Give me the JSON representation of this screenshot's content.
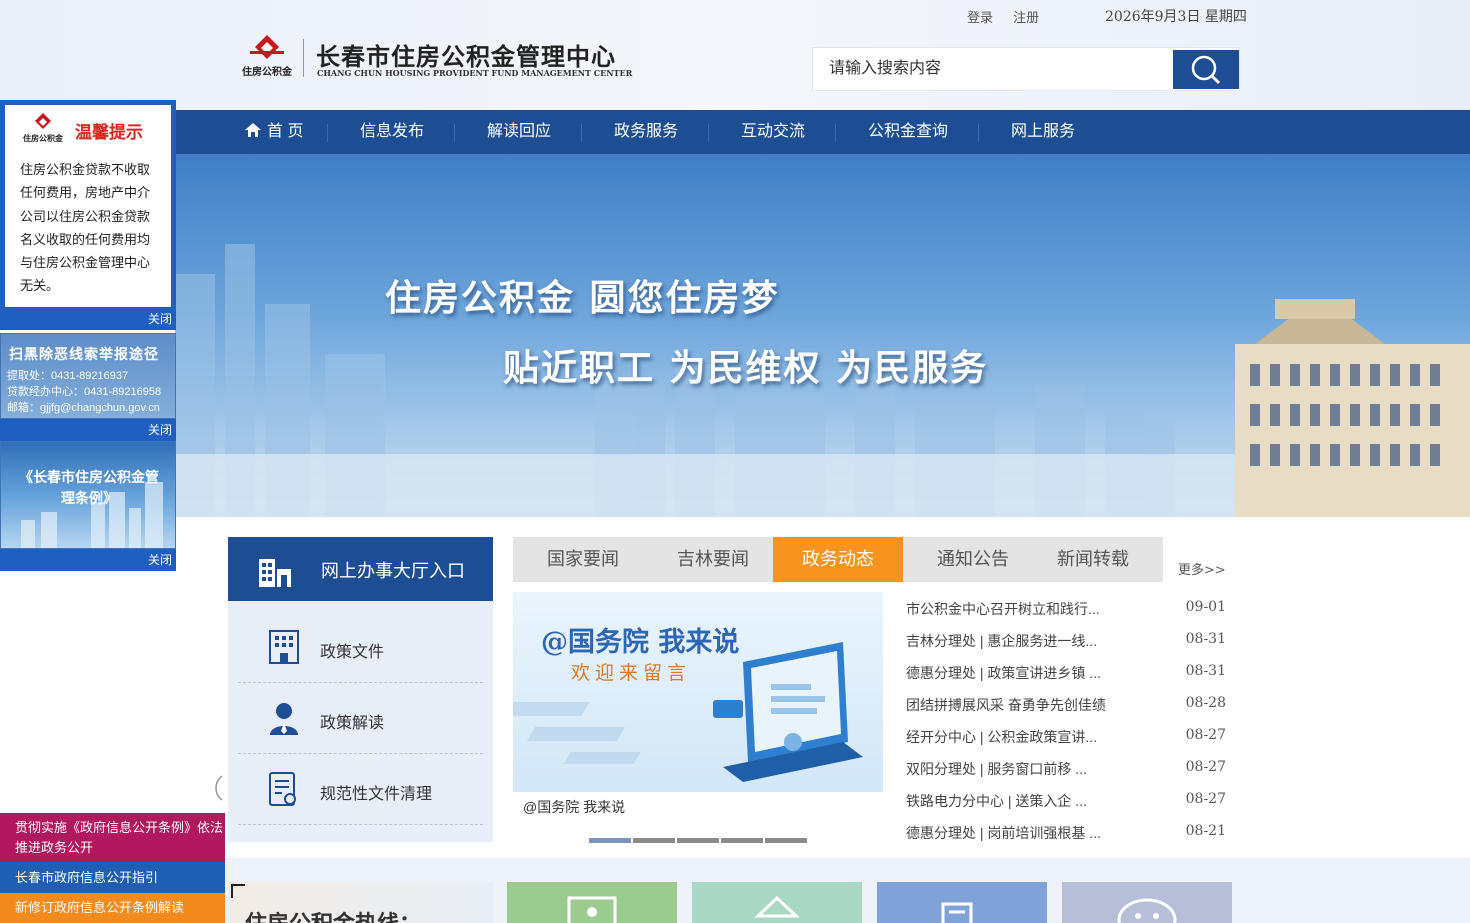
{
  "header": {
    "login": "登录",
    "register": "注册",
    "date": "2026年9月3日 星期四",
    "logo_cn": "长春市住房公积金管理中心",
    "logo_en": "CHANG CHUN HOUSING PROVIDENT FUND MANAGEMENT CENTER",
    "logo_mark_text": "住房公积金",
    "search_placeholder": "请输入搜索内容"
  },
  "nav": [
    "首 页",
    "信息发布",
    "解读回应",
    "政务服务",
    "互动交流",
    "公积金查询",
    "网上服务"
  ],
  "banner": {
    "slogan1": "住房公积金  圆您住房梦",
    "slogan2": "贴近职工  为民维权  为民服务"
  },
  "floats": {
    "tip_title": "温馨提示",
    "tip_body": "住房公积金贷款不收取任何费用，房地产中介公司以住房公积金贷款名义收取的任何费用均与住房公积金管理中心无关。",
    "close": "关闭",
    "report_title": "扫黑除恶线索举报途径",
    "report_lines": [
      "提取处：0431-89216937",
      "贷款经办中心：0431-89216958",
      "邮箱：gjjfg@changchun.gov.cn"
    ],
    "regs_title": "《长春市住房公积金管理条例》"
  },
  "bottom_left": [
    "贯彻实施《政府信息公开条例》依法推进政务公开",
    "长春市政府信息公开指引",
    "新修订政府信息公开条例解读"
  ],
  "left_panel": {
    "hall": "网上办事大厅入口",
    "items": [
      "政策文件",
      "政策解读",
      "规范性文件清理"
    ]
  },
  "tabs": [
    "国家要闻",
    "吉林要闻",
    "政务动态",
    "通知公告",
    "新闻转载"
  ],
  "active_tab": 2,
  "more": "更多>>",
  "slide": {
    "headline": "@国务院 我来说",
    "sub": "欢迎来留言",
    "caption": "@国务院 我来说"
  },
  "news": [
    {
      "title": "市公积金中心召开树立和践行...",
      "date": "09-01"
    },
    {
      "title": "吉林分理处 | 惠企服务进一线...",
      "date": "08-31"
    },
    {
      "title": "德惠分理处 | 政策宣讲进乡镇 ...",
      "date": "08-31"
    },
    {
      "title": "团结拼搏展风采 奋勇争先创佳绩",
      "date": "08-28"
    },
    {
      "title": "经开分中心 | 公积金政策宣讲...",
      "date": "08-27"
    },
    {
      "title": "双阳分理处 | 服务窗口前移 ...",
      "date": "08-27"
    },
    {
      "title": "铁路电力分中心 | 送策入企 ...",
      "date": "08-27"
    },
    {
      "title": "德惠分理处 | 岗前培训强根基 ...",
      "date": "08-21"
    }
  ],
  "hotline": "住房公积金热线：",
  "colors": {
    "nav": "#1d4e94",
    "active_tab": "#f7931e",
    "tip_red": "#d9251c",
    "quick": [
      "#9ccb8e",
      "#a9d8c4",
      "#7fa3d8",
      "#b7bfd8"
    ]
  }
}
